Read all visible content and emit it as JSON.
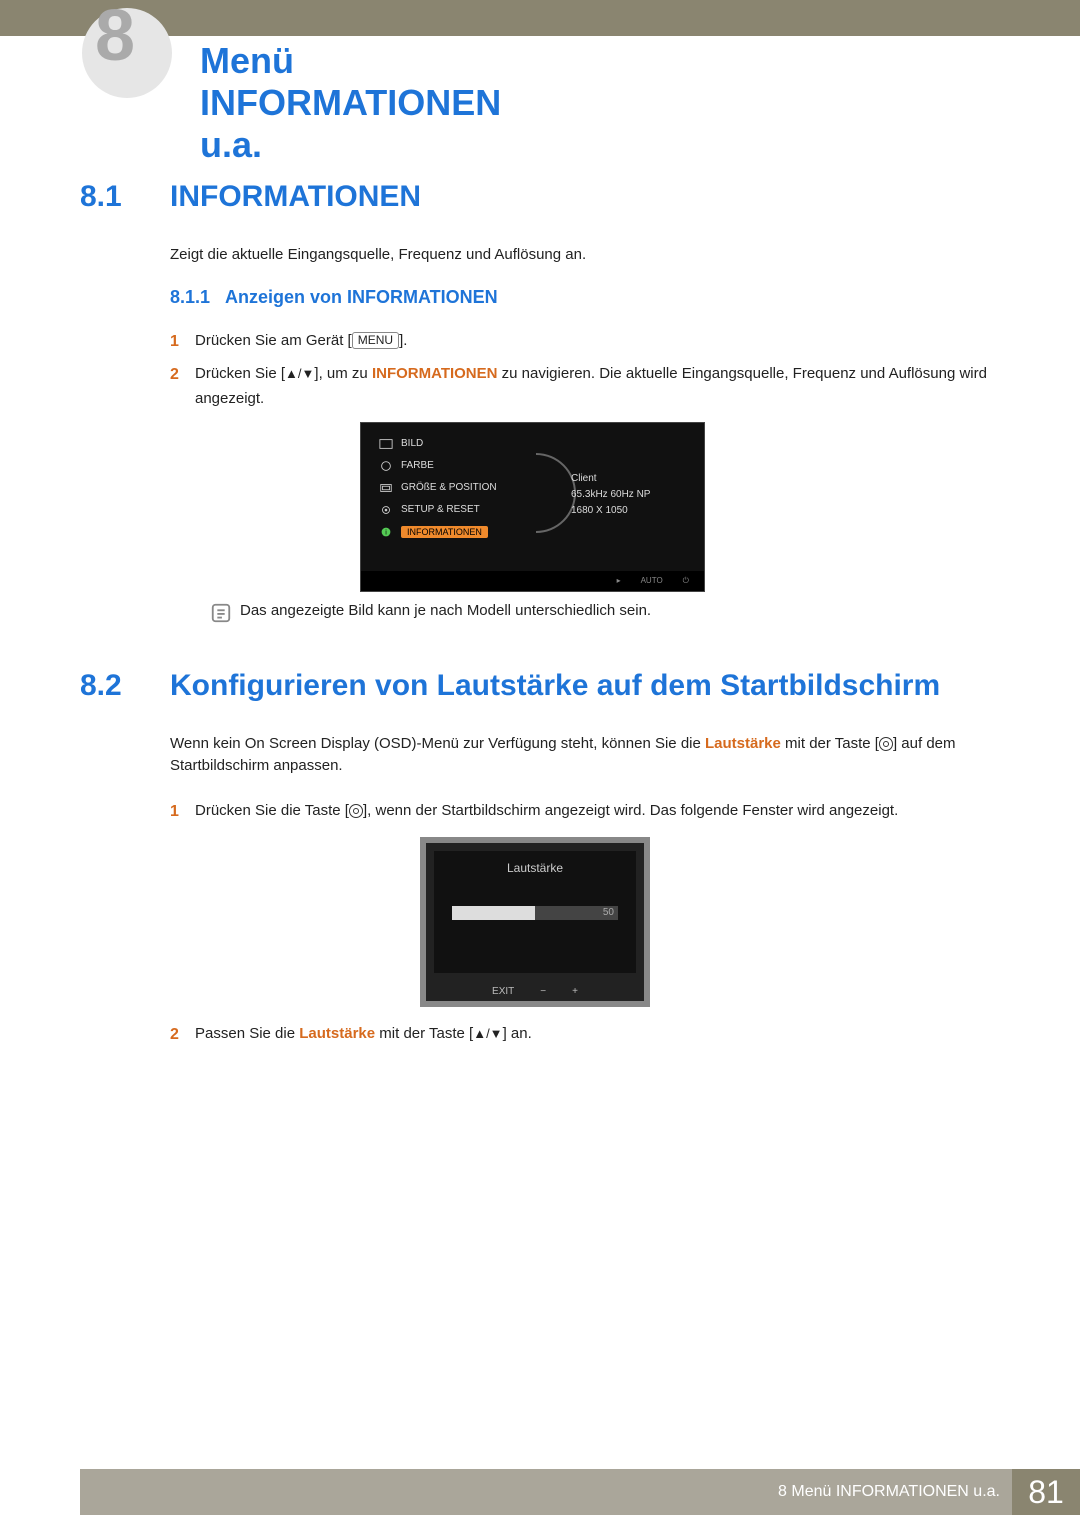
{
  "chapter": {
    "number": "8",
    "title": "Menü INFORMATIONEN u.a."
  },
  "s81": {
    "num": "8.1",
    "title": "INFORMATIONEN",
    "intro": "Zeigt die aktuelle Eingangsquelle, Frequenz und Auflösung an.",
    "sub": {
      "num": "8.1.1",
      "title": "Anzeigen von INFORMATIONEN"
    },
    "step1_a": "Drücken Sie am Gerät [",
    "step1_btn": "MENU",
    "step1_b": "].",
    "step2_a": "Drücken Sie [",
    "step2_arrows": "▲/▼",
    "step2_b": "], um zu ",
    "step2_kw": "INFORMATIONEN",
    "step2_c": " zu navigieren. Die aktuelle Eingangsquelle, Frequenz und Auflösung wird angezeigt.",
    "note": "Das angezeigte Bild kann je nach Modell unterschiedlich sein."
  },
  "osd1": {
    "items": [
      "BILD",
      "FARBE",
      "GRÖßE & POSITION",
      "SETUP & RESET",
      "INFORMATIONEN"
    ],
    "info": [
      "Client",
      "65.3kHz 60Hz NP",
      "1680 X 1050"
    ],
    "auto": "AUTO"
  },
  "s82": {
    "num": "8.2",
    "title": "Konfigurieren von Lautstärke auf dem Startbildschirm",
    "intro_a": "Wenn kein On Screen Display (OSD)-Menü zur Verfügung steht, können Sie die ",
    "intro_kw": "Lautstärke",
    "intro_b": " mit der Taste [",
    "intro_c": "] auf dem Startbildschirm anpassen.",
    "step1_a": "Drücken Sie die Taste [",
    "step1_b": "], wenn der Startbildschirm angezeigt wird. Das folgende Fenster wird angezeigt.",
    "step2_a": "Passen Sie die ",
    "step2_kw": "Lautstärke",
    "step2_b": " mit der Taste [",
    "step2_arrows": "▲/▼",
    "step2_c": "] an."
  },
  "osd2": {
    "title": "Lautstärke",
    "value": "50",
    "exit": "EXIT",
    "minus": "−",
    "plus": "+"
  },
  "footer": {
    "text": "8 Menü INFORMATIONEN u.a.",
    "page": "81"
  }
}
